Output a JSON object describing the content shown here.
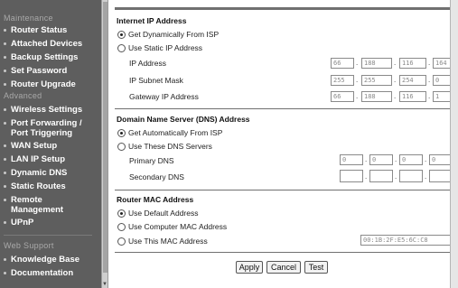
{
  "sidebar": {
    "sections": [
      {
        "label": "Maintenance",
        "items": [
          "Router Status",
          "Attached Devices",
          "Backup Settings",
          "Set Password",
          "Router Upgrade"
        ]
      },
      {
        "label": "Advanced",
        "items": [
          "Wireless Settings",
          "Port Forwarding / Port Triggering",
          "WAN Setup",
          "LAN IP Setup",
          "Dynamic DNS",
          "Static Routes",
          "Remote Management",
          "UPnP"
        ]
      },
      {
        "label": "Web Support",
        "items": [
          "Knowledge Base",
          "Documentation"
        ]
      }
    ],
    "labels": {
      "maintenance": "Maintenance",
      "router_status": "Router Status",
      "attached_devices": "Attached Devices",
      "backup_settings": "Backup Settings",
      "set_password": "Set Password",
      "router_upgrade": "Router Upgrade",
      "advanced": "Advanced",
      "wireless_settings": "Wireless Settings",
      "port_forwarding_1": "Port Forwarding /",
      "port_forwarding_2": "Port Triggering",
      "wan_setup": "WAN Setup",
      "lan_ip_setup": "LAN IP Setup",
      "dynamic_dns": "Dynamic DNS",
      "static_routes": "Static Routes",
      "remote_management_1": "Remote",
      "remote_management_2": "Management",
      "upnp": "UPnP",
      "web_support": "Web Support",
      "knowledge_base": "Knowledge Base",
      "documentation": "Documentation"
    }
  },
  "internet_ip": {
    "title": "Internet IP Address",
    "option_dynamic": "Get Dynamically From ISP",
    "option_static": "Use Static IP Address",
    "selected": "dynamic",
    "ip_label": "IP Address",
    "ip": [
      "66",
      "188",
      "116",
      "164"
    ],
    "mask_label": "IP Subnet Mask",
    "mask": [
      "255",
      "255",
      "254",
      "0"
    ],
    "gateway_label": "Gateway IP Address",
    "gateway": [
      "66",
      "188",
      "116",
      "1"
    ]
  },
  "dns": {
    "title": "Domain Name Server (DNS) Address",
    "option_auto": "Get Automatically From ISP",
    "option_manual": "Use These DNS Servers",
    "selected": "auto",
    "primary_label": "Primary DNS",
    "primary": [
      "0",
      "0",
      "0",
      "0"
    ],
    "secondary_label": "Secondary DNS",
    "secondary": [
      "",
      "",
      "",
      ""
    ]
  },
  "mac": {
    "title": "Router MAC Address",
    "option_default": "Use Default Address",
    "option_computer": "Use Computer MAC Address",
    "option_this": "Use This MAC Address",
    "selected": "default",
    "value": "00:1B:2F:E5:6C:C8"
  },
  "buttons": {
    "apply": "Apply",
    "cancel": "Cancel",
    "test": "Test"
  },
  "colors": {
    "sidebar_bg": "#5e5e5e",
    "sidebar_section": "#a9a9a9",
    "sidebar_item": "#ffffff"
  }
}
